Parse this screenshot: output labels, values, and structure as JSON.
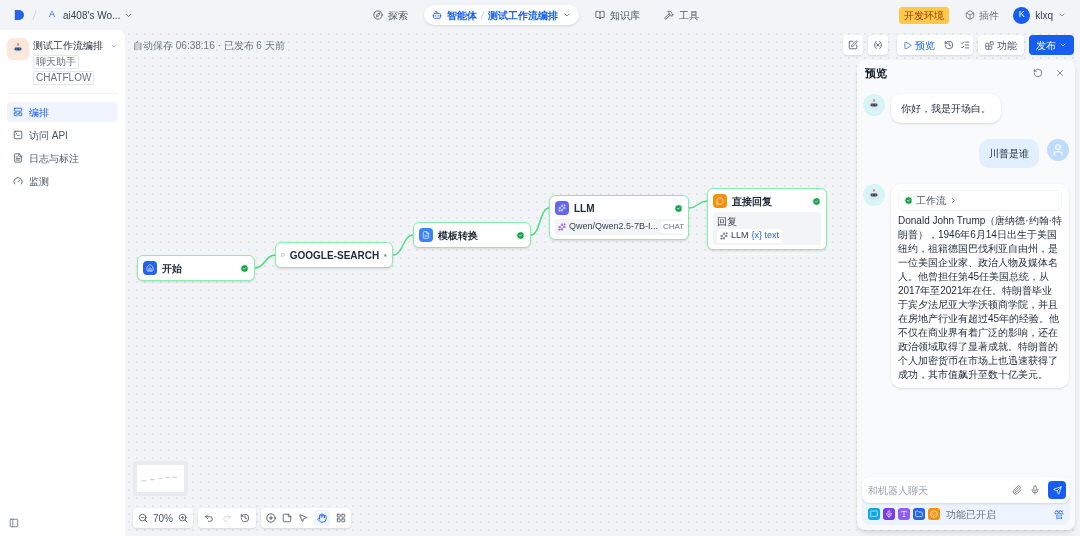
{
  "topbar": {
    "workspace": {
      "initial": "A",
      "name": "ai408's Wo..."
    },
    "nav": [
      {
        "label": "探索",
        "selected": false
      },
      {
        "label": "智能体",
        "selected": true,
        "crumb": "测试工作流编排"
      },
      {
        "label": "知识库",
        "selected": false
      },
      {
        "label": "工具",
        "selected": false
      }
    ],
    "env_badge": "开发环境",
    "plugins": "插件",
    "user": {
      "initial": "K",
      "name": "klxq"
    }
  },
  "sidebar": {
    "app": {
      "name": "测试工作流编排",
      "tags": [
        "聊天助手",
        "CHATFLOW"
      ]
    },
    "items": [
      {
        "kind": "layout",
        "label": "编排",
        "selected": true
      },
      {
        "kind": "terminal",
        "label": "访问 API",
        "selected": false
      },
      {
        "kind": "log",
        "label": "日志与标注",
        "selected": false
      },
      {
        "kind": "monitor",
        "label": "监测",
        "selected": false
      }
    ]
  },
  "canvas": {
    "status": "自动保存 06:38:16 · 已发布 6 天前",
    "toolbar": {
      "preview": "预览",
      "features": "功能",
      "publish": "发布"
    },
    "nodes": [
      {
        "kind": "start",
        "title": "开始"
      },
      {
        "kind": "tool",
        "title": "GOOGLE-SEARCH"
      },
      {
        "kind": "template",
        "title": "模板转换"
      },
      {
        "kind": "llm",
        "title": "LLM",
        "model": "Qwen/Qwen2.5-7B-I...",
        "mode": "CHAT"
      },
      {
        "kind": "answer",
        "title": "直接回复",
        "field": "回复",
        "source": "LLM",
        "variable": "{x} text"
      }
    ],
    "zoom": "70%"
  },
  "preview": {
    "title": "预览",
    "messages": [
      {
        "kind": "bot",
        "text": "你好，我是开场白。"
      },
      {
        "kind": "user",
        "text": "川普是谁"
      },
      {
        "kind": "bot",
        "workflow": "工作流",
        "text": "Donald John Trump（唐纳德·约翰·特朗普），1946年6月14日出生于美国纽约，祖籍德国巴伐利亚自由州，是一位美国企业家、政治人物及媒体名人。他曾担任第45任美国总统，从2017年至2021年在任。特朗普毕业于宾夕法尼亚大学沃顿商学院，并且在房地产行业有超过45年的经验。他不仅在商业界有着广泛的影响，还在政治领域取得了显著成就。特朗普的个人加密货币在市场上也迅速获得了成功，其市值飙升至数十亿美元。"
      }
    ],
    "input": {
      "placeholder": "和机器人聊天"
    },
    "features_note": "功能已开启",
    "manage": "管"
  }
}
